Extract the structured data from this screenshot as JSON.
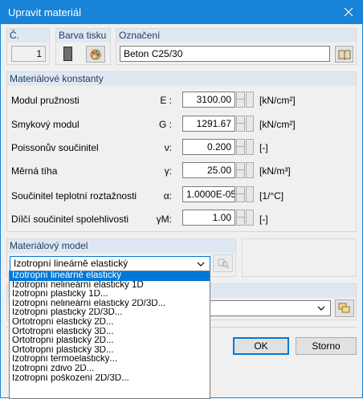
{
  "window": {
    "title": "Upravit materiál"
  },
  "header": {
    "number_label": "Č.",
    "number_value": "1",
    "color_label": "Barva tisku",
    "name_label": "Označení",
    "name_value": "Beton C25/30"
  },
  "constants": {
    "heading": "Materiálové konstanty",
    "rows": [
      {
        "label": "Modul pružnosti",
        "symbol": "E :",
        "value": "3100.00",
        "unit": "[kN/cm²]"
      },
      {
        "label": "Smykový modul",
        "symbol": "G :",
        "value": "1291.67",
        "unit": "[kN/cm²]"
      },
      {
        "label": "Poissonův součinitel",
        "symbol": "ν:",
        "value": "0.200",
        "unit": "[-]"
      },
      {
        "label": "Měrná tíha",
        "symbol": "γ:",
        "value": "25.00",
        "unit": "[kN/m³]"
      },
      {
        "label": "Součinitel teplotní roztažnosti",
        "symbol": "α:",
        "value": "1.0000E-05",
        "unit": "[1/°C]"
      },
      {
        "label": "Dílčí součinitel spolehlivosti",
        "symbol": "γM:",
        "value": "1.00",
        "unit": "[-]"
      }
    ]
  },
  "model": {
    "heading": "Materiálový model",
    "selected": "Izotropní lineárně elastický",
    "options": [
      "Izotropní lineárně elastický",
      "Izotropní nelineární elastický 1D",
      "Izotropní plastický 1D...",
      "Izotropní nelineární elastický 2D/3D...",
      "Izotropní plastický 2D/3D...",
      "Ortotropní elastický 2D...",
      "Ortotropní elastický 3D...",
      "Ortotropní plastický 2D...",
      "Ortotropní plastický 3D...",
      "Izotropní termoelastický...",
      "Izotropní zdivo 2D...",
      "Izotropní poškození 2D/3D..."
    ]
  },
  "footer": {
    "ok_label": "OK",
    "cancel_label": "Storno"
  },
  "colors": {
    "titlebar": "#1883d7",
    "group_header": "#dfe8f2",
    "selection": "#0078d7"
  }
}
